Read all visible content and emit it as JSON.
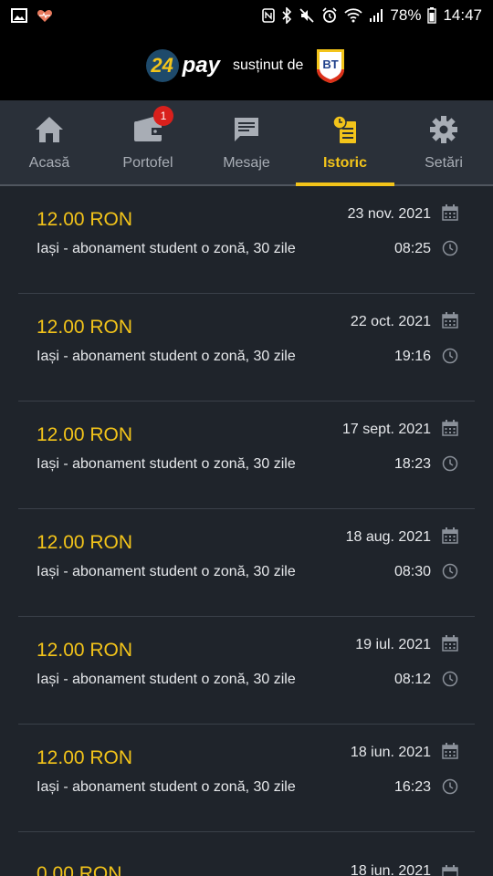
{
  "status": {
    "battery": "78%",
    "time": "14:47"
  },
  "brand": {
    "logo_number": "24",
    "logo_text": "pay",
    "supported_by": "susținut de",
    "bank_logo": "BT"
  },
  "nav": {
    "items": [
      {
        "label": "Acasă",
        "icon": "home-icon"
      },
      {
        "label": "Portofel",
        "icon": "wallet-icon",
        "badge": "1"
      },
      {
        "label": "Mesaje",
        "icon": "message-icon"
      },
      {
        "label": "Istoric",
        "icon": "history-icon",
        "active": true
      },
      {
        "label": "Setări",
        "icon": "gear-icon"
      }
    ]
  },
  "transactions": [
    {
      "amount": "12.00 RON",
      "description": "Iași - abonament student o zonă, 30 zile",
      "date": "23 nov. 2021",
      "time": "08:25"
    },
    {
      "amount": "12.00 RON",
      "description": "Iași - abonament student o zonă, 30 zile",
      "date": "22 oct. 2021",
      "time": "19:16"
    },
    {
      "amount": "12.00 RON",
      "description": "Iași - abonament student o zonă, 30 zile",
      "date": "17 sept. 2021",
      "time": "18:23"
    },
    {
      "amount": "12.00 RON",
      "description": "Iași - abonament student o zonă, 30 zile",
      "date": "18 aug. 2021",
      "time": "08:30"
    },
    {
      "amount": "12.00 RON",
      "description": "Iași - abonament student o zonă, 30 zile",
      "date": "19 iul. 2021",
      "time": "08:12"
    },
    {
      "amount": "12.00 RON",
      "description": "Iași - abonament student o zonă, 30 zile",
      "date": "18 iun. 2021",
      "time": "16:23"
    },
    {
      "amount": "0.00 RON",
      "date": "18 iun. 2021"
    }
  ],
  "colors": {
    "accent": "#f3c41a",
    "background": "#1f242b",
    "nav_background": "#2a3039",
    "badge": "#d9201c"
  }
}
